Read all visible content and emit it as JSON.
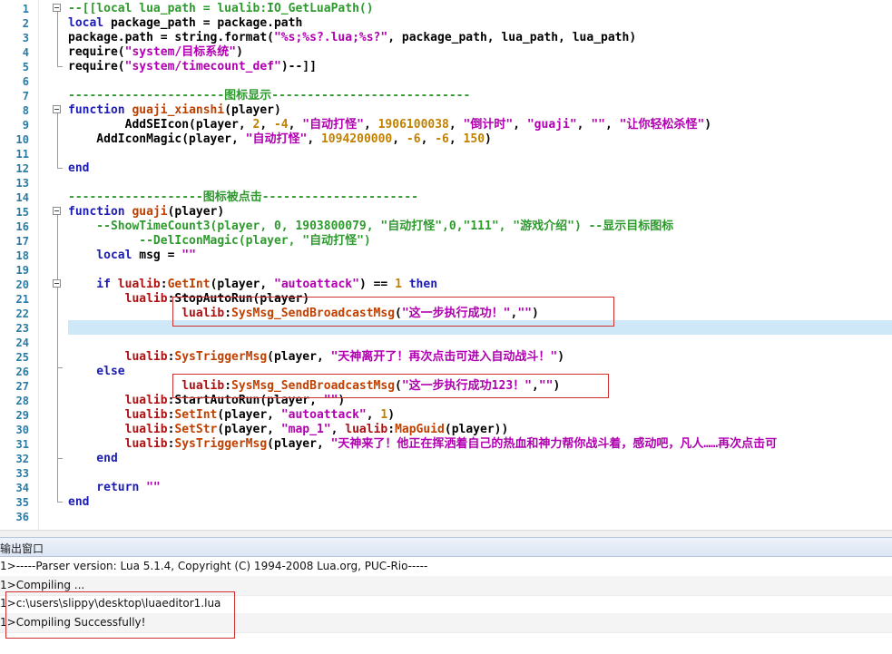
{
  "editor": {
    "line_numbers": [
      "1",
      "2",
      "3",
      "4",
      "5",
      "6",
      "7",
      "8",
      "9",
      "10",
      "11",
      "12",
      "13",
      "14",
      "15",
      "16",
      "17",
      "18",
      "19",
      "20",
      "21",
      "22",
      "23",
      "24",
      "25",
      "26",
      "27",
      "28",
      "29",
      "30",
      "31",
      "32",
      "33",
      "34",
      "35",
      "36"
    ],
    "lines": [
      [
        [
          "c-cmt",
          "--[[local lua_path = lualib:IO_GetLuaPath()"
        ]
      ],
      [
        [
          "c-kw",
          "local "
        ],
        [
          "c-id",
          "package_path = package.path"
        ]
      ],
      [
        [
          "c-id",
          "package.path = string.format("
        ],
        [
          "c-str",
          "\"%s;%s?.lua;%s?\""
        ],
        [
          "c-id",
          ", package_path, lua_path, lua_path)"
        ]
      ],
      [
        [
          "c-id",
          "require("
        ],
        [
          "c-str",
          "\"system/目标系统\""
        ],
        [
          "c-id",
          ")"
        ]
      ],
      [
        [
          "c-id",
          "require("
        ],
        [
          "c-str",
          "\"system/timecount_def\""
        ],
        [
          "c-id",
          ")--]]"
        ]
      ],
      [],
      [
        [
          "c-cmt",
          "----------------------图标显示----------------------------"
        ]
      ],
      [
        [
          "c-kw",
          "function "
        ],
        [
          "c-fn",
          "guaji_xianshi"
        ],
        [
          "c-id",
          "(player)"
        ]
      ],
      [
        [
          "c-id",
          "        AddSEIcon(player, "
        ],
        [
          "c-num",
          "2"
        ],
        [
          "c-id",
          ", "
        ],
        [
          "c-num",
          "-4"
        ],
        [
          "c-id",
          ", "
        ],
        [
          "c-str",
          "\"自动打怪\""
        ],
        [
          "c-id",
          ", "
        ],
        [
          "c-num",
          "1906100038"
        ],
        [
          "c-id",
          ", "
        ],
        [
          "c-str",
          "\"倒计时\""
        ],
        [
          "c-id",
          ", "
        ],
        [
          "c-str",
          "\"guaji\""
        ],
        [
          "c-id",
          ", "
        ],
        [
          "c-str",
          "\"\""
        ],
        [
          "c-id",
          ", "
        ],
        [
          "c-str",
          "\"让你轻松杀怪\""
        ],
        [
          "c-id",
          ")"
        ]
      ],
      [
        [
          "c-id",
          "    AddIconMagic(player, "
        ],
        [
          "c-str",
          "\"自动打怪\""
        ],
        [
          "c-id",
          ", "
        ],
        [
          "c-num",
          "1094200000"
        ],
        [
          "c-id",
          ", "
        ],
        [
          "c-num",
          "-6"
        ],
        [
          "c-id",
          ", "
        ],
        [
          "c-num",
          "-6"
        ],
        [
          "c-id",
          ", "
        ],
        [
          "c-num",
          "150"
        ],
        [
          "c-id",
          ")"
        ]
      ],
      [],
      [
        [
          "c-kw",
          "end"
        ]
      ],
      [],
      [
        [
          "c-cmt",
          "-------------------图标被点击----------------------"
        ]
      ],
      [
        [
          "c-kw",
          "function "
        ],
        [
          "c-fn",
          "guaji"
        ],
        [
          "c-id",
          "(player)"
        ]
      ],
      [
        [
          "c-cmt",
          "    --ShowTimeCount3(player, 0, 1903800079, \"自动打怪\",0,\"111\", \"游戏介绍\") --显示目标图标"
        ]
      ],
      [
        [
          "c-cmt",
          "          --DelIconMagic(player, \"自动打怪\")"
        ]
      ],
      [
        [
          "c-kw",
          "    local "
        ],
        [
          "c-id",
          "msg = "
        ],
        [
          "c-str",
          "\"\""
        ]
      ],
      [],
      [
        [
          "c-kw",
          "    if "
        ],
        [
          "c-lib",
          "lualib"
        ],
        [
          "c-id",
          ":"
        ],
        [
          "c-fn",
          "GetInt"
        ],
        [
          "c-id",
          "(player, "
        ],
        [
          "c-str",
          "\"autoattack\""
        ],
        [
          "c-id",
          ") == "
        ],
        [
          "c-num",
          "1"
        ],
        [
          "c-kw",
          " then"
        ]
      ],
      [
        [
          "c-lib",
          "        lualib"
        ],
        [
          "c-id",
          ":StopAutoRun(player)"
        ]
      ],
      [
        [
          "c-lib",
          "                lualib"
        ],
        [
          "c-id",
          ":"
        ],
        [
          "c-fn",
          "SysMsg_SendBroadcastMsg"
        ],
        [
          "c-id",
          "("
        ],
        [
          "c-str",
          "\"这一步执行成功！\""
        ],
        [
          "c-id",
          ","
        ],
        [
          "c-str",
          "\"\""
        ],
        [
          "c-id",
          ")"
        ]
      ],
      [
        [
          "c-id",
          "        "
        ]
      ],
      [],
      [
        [
          "c-lib",
          "        lualib"
        ],
        [
          "c-id",
          ":"
        ],
        [
          "c-fn",
          "SysTriggerMsg"
        ],
        [
          "c-id",
          "(player, "
        ],
        [
          "c-str",
          "\"天神离开了！再次点击可进入自动战斗！\""
        ],
        [
          "c-id",
          ")"
        ]
      ],
      [
        [
          "c-kw",
          "    else"
        ]
      ],
      [
        [
          "c-lib",
          "                lualib"
        ],
        [
          "c-id",
          ":"
        ],
        [
          "c-fn",
          "SysMsg_SendBroadcastMsg"
        ],
        [
          "c-id",
          "("
        ],
        [
          "c-str",
          "\"这一步执行成功123！\""
        ],
        [
          "c-id",
          ","
        ],
        [
          "c-str",
          "\"\""
        ],
        [
          "c-id",
          ")"
        ]
      ],
      [
        [
          "c-lib",
          "        lualib"
        ],
        [
          "c-id",
          ":StartAutoRun(player, "
        ],
        [
          "c-str",
          "\"\""
        ],
        [
          "c-id",
          ")"
        ]
      ],
      [
        [
          "c-lib",
          "        lualib"
        ],
        [
          "c-id",
          ":"
        ],
        [
          "c-fn",
          "SetInt"
        ],
        [
          "c-id",
          "(player, "
        ],
        [
          "c-str",
          "\"autoattack\""
        ],
        [
          "c-id",
          ", "
        ],
        [
          "c-num",
          "1"
        ],
        [
          "c-id",
          ")"
        ]
      ],
      [
        [
          "c-lib",
          "        lualib"
        ],
        [
          "c-id",
          ":"
        ],
        [
          "c-fn",
          "SetStr"
        ],
        [
          "c-id",
          "(player, "
        ],
        [
          "c-str",
          "\"map_1\""
        ],
        [
          "c-id",
          ", "
        ],
        [
          "c-lib",
          "lualib"
        ],
        [
          "c-id",
          ":"
        ],
        [
          "c-fn",
          "MapGuid"
        ],
        [
          "c-id",
          "(player))"
        ]
      ],
      [
        [
          "c-lib",
          "        lualib"
        ],
        [
          "c-id",
          ":"
        ],
        [
          "c-fn",
          "SysTriggerMsg"
        ],
        [
          "c-id",
          "(player, "
        ],
        [
          "c-str",
          "\"天神来了！他正在挥洒着自己的热血和神力帮你战斗着，感动吧，凡人……再次点击可"
        ]
      ],
      [
        [
          "c-kw",
          "    end"
        ]
      ],
      [],
      [
        [
          "c-kw",
          "    return "
        ],
        [
          "c-str",
          "\"\""
        ]
      ],
      [
        [
          "c-kw",
          "end"
        ]
      ],
      []
    ]
  },
  "output_panel": {
    "title": "输出窗口",
    "lines": [
      "1>-----Parser version: Lua 5.1.4, Copyright (C) 1994-2008 Lua.org, PUC-Rio-----",
      "1>Compiling ...",
      "1>c:\\users\\slippy\\desktop\\luaeditor1.lua",
      "1>Compiling Successfully!"
    ]
  },
  "colors": {
    "keyword": "#1c1cb5",
    "comment": "#2e9a2e",
    "string": "#b000b0",
    "number": "#c08000",
    "highlight_box": "#d03030",
    "current_line": "#cfe8f7"
  }
}
